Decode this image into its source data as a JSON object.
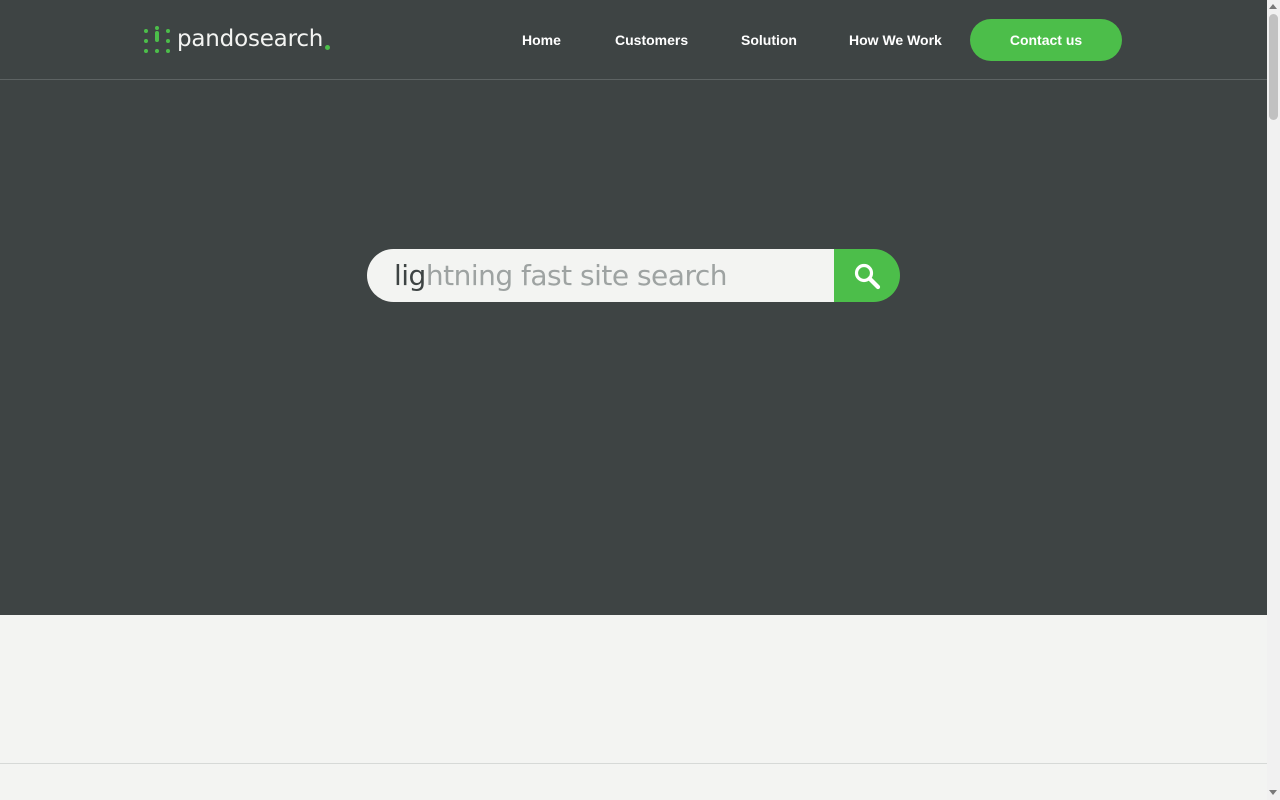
{
  "brand": {
    "name": "pandosearch",
    "accent_color": "#4cbe4a",
    "dark_color": "#3e4444",
    "light_color": "#f3f4f2"
  },
  "nav": {
    "home": "Home",
    "customers": "Customers",
    "solution": "Solution",
    "how_we_work": "How We Work",
    "contact": "Contact us"
  },
  "search": {
    "typed_text": "lig",
    "ghost_text": "htning fast site search",
    "button_icon": "search-icon"
  }
}
